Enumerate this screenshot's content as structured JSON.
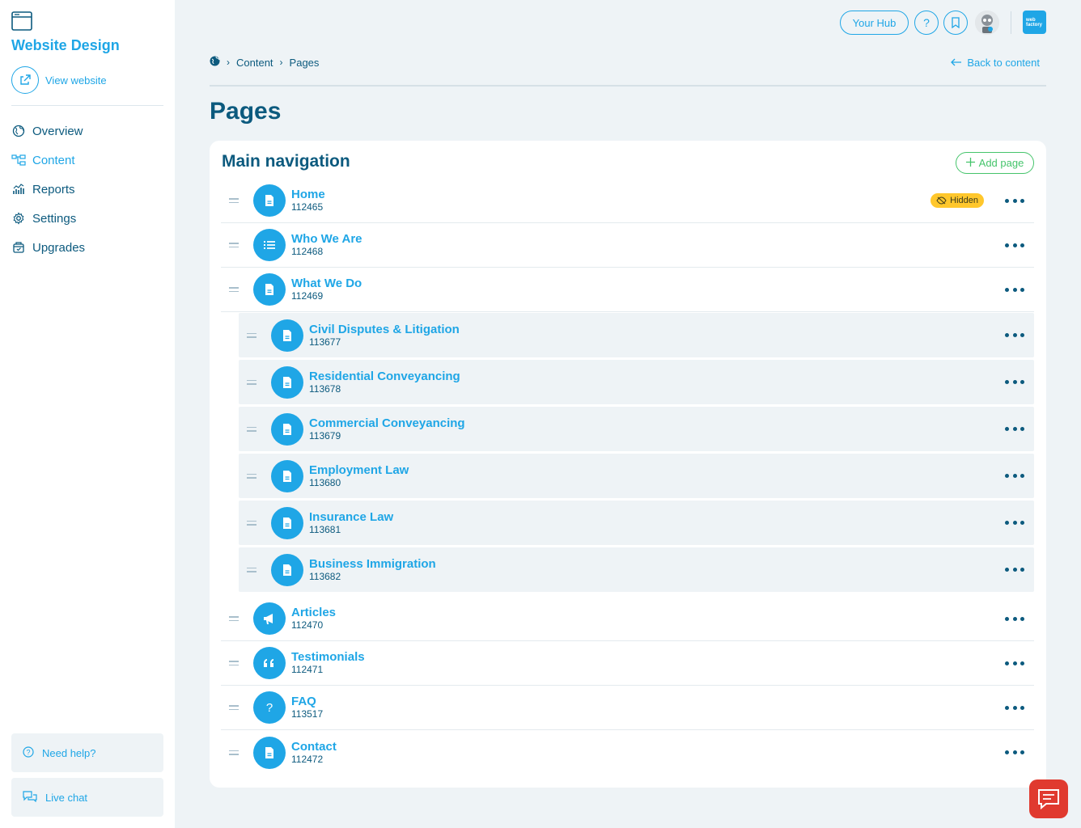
{
  "sidebar": {
    "title": "Website Design",
    "view_website": "View website",
    "nav": [
      {
        "label": "Overview",
        "icon": "globe-icon"
      },
      {
        "label": "Content",
        "icon": "sitemap-icon"
      },
      {
        "label": "Reports",
        "icon": "chart-icon"
      },
      {
        "label": "Settings",
        "icon": "gear-icon"
      },
      {
        "label": "Upgrades",
        "icon": "box-icon"
      }
    ],
    "help": "Need help?",
    "chat": "Live chat"
  },
  "topbar": {
    "hub": "Your Hub",
    "help_glyph": "?",
    "logo_text": "web factory"
  },
  "breadcrumb": {
    "items": [
      "Content",
      "Pages"
    ],
    "back": "Back to content"
  },
  "page": {
    "title": "Pages"
  },
  "card": {
    "title": "Main navigation",
    "add_label": "Add page",
    "hidden_label": "Hidden",
    "rows": [
      {
        "name": "Home",
        "id": "112465",
        "icon": "document-icon"
      },
      {
        "name": "Who We Are",
        "id": "112468",
        "icon": "list-icon"
      },
      {
        "name": "What We Do",
        "id": "112469",
        "icon": "document-icon"
      },
      {
        "name": "Civil Disputes & Litigation",
        "id": "113677",
        "icon": "document-icon"
      },
      {
        "name": "Residential Conveyancing",
        "id": "113678",
        "icon": "document-icon"
      },
      {
        "name": "Commercial Conveyancing",
        "id": "113679",
        "icon": "document-icon"
      },
      {
        "name": "Employment Law",
        "id": "113680",
        "icon": "document-icon"
      },
      {
        "name": "Insurance Law",
        "id": "113681",
        "icon": "document-icon"
      },
      {
        "name": "Business Immigration",
        "id": "113682",
        "icon": "document-icon"
      },
      {
        "name": "Articles",
        "id": "112470",
        "icon": "megaphone-icon"
      },
      {
        "name": "Testimonials",
        "id": "112471",
        "icon": "quote-icon"
      },
      {
        "name": "FAQ",
        "id": "113517",
        "icon": "question-icon"
      },
      {
        "name": "Contact",
        "id": "112472",
        "icon": "document-icon"
      }
    ]
  },
  "colors": {
    "accent": "#1fa6e6",
    "navy": "#0c5a7e",
    "green": "#45c46b",
    "badge": "#ffc72c",
    "chat": "#e03a2f"
  }
}
